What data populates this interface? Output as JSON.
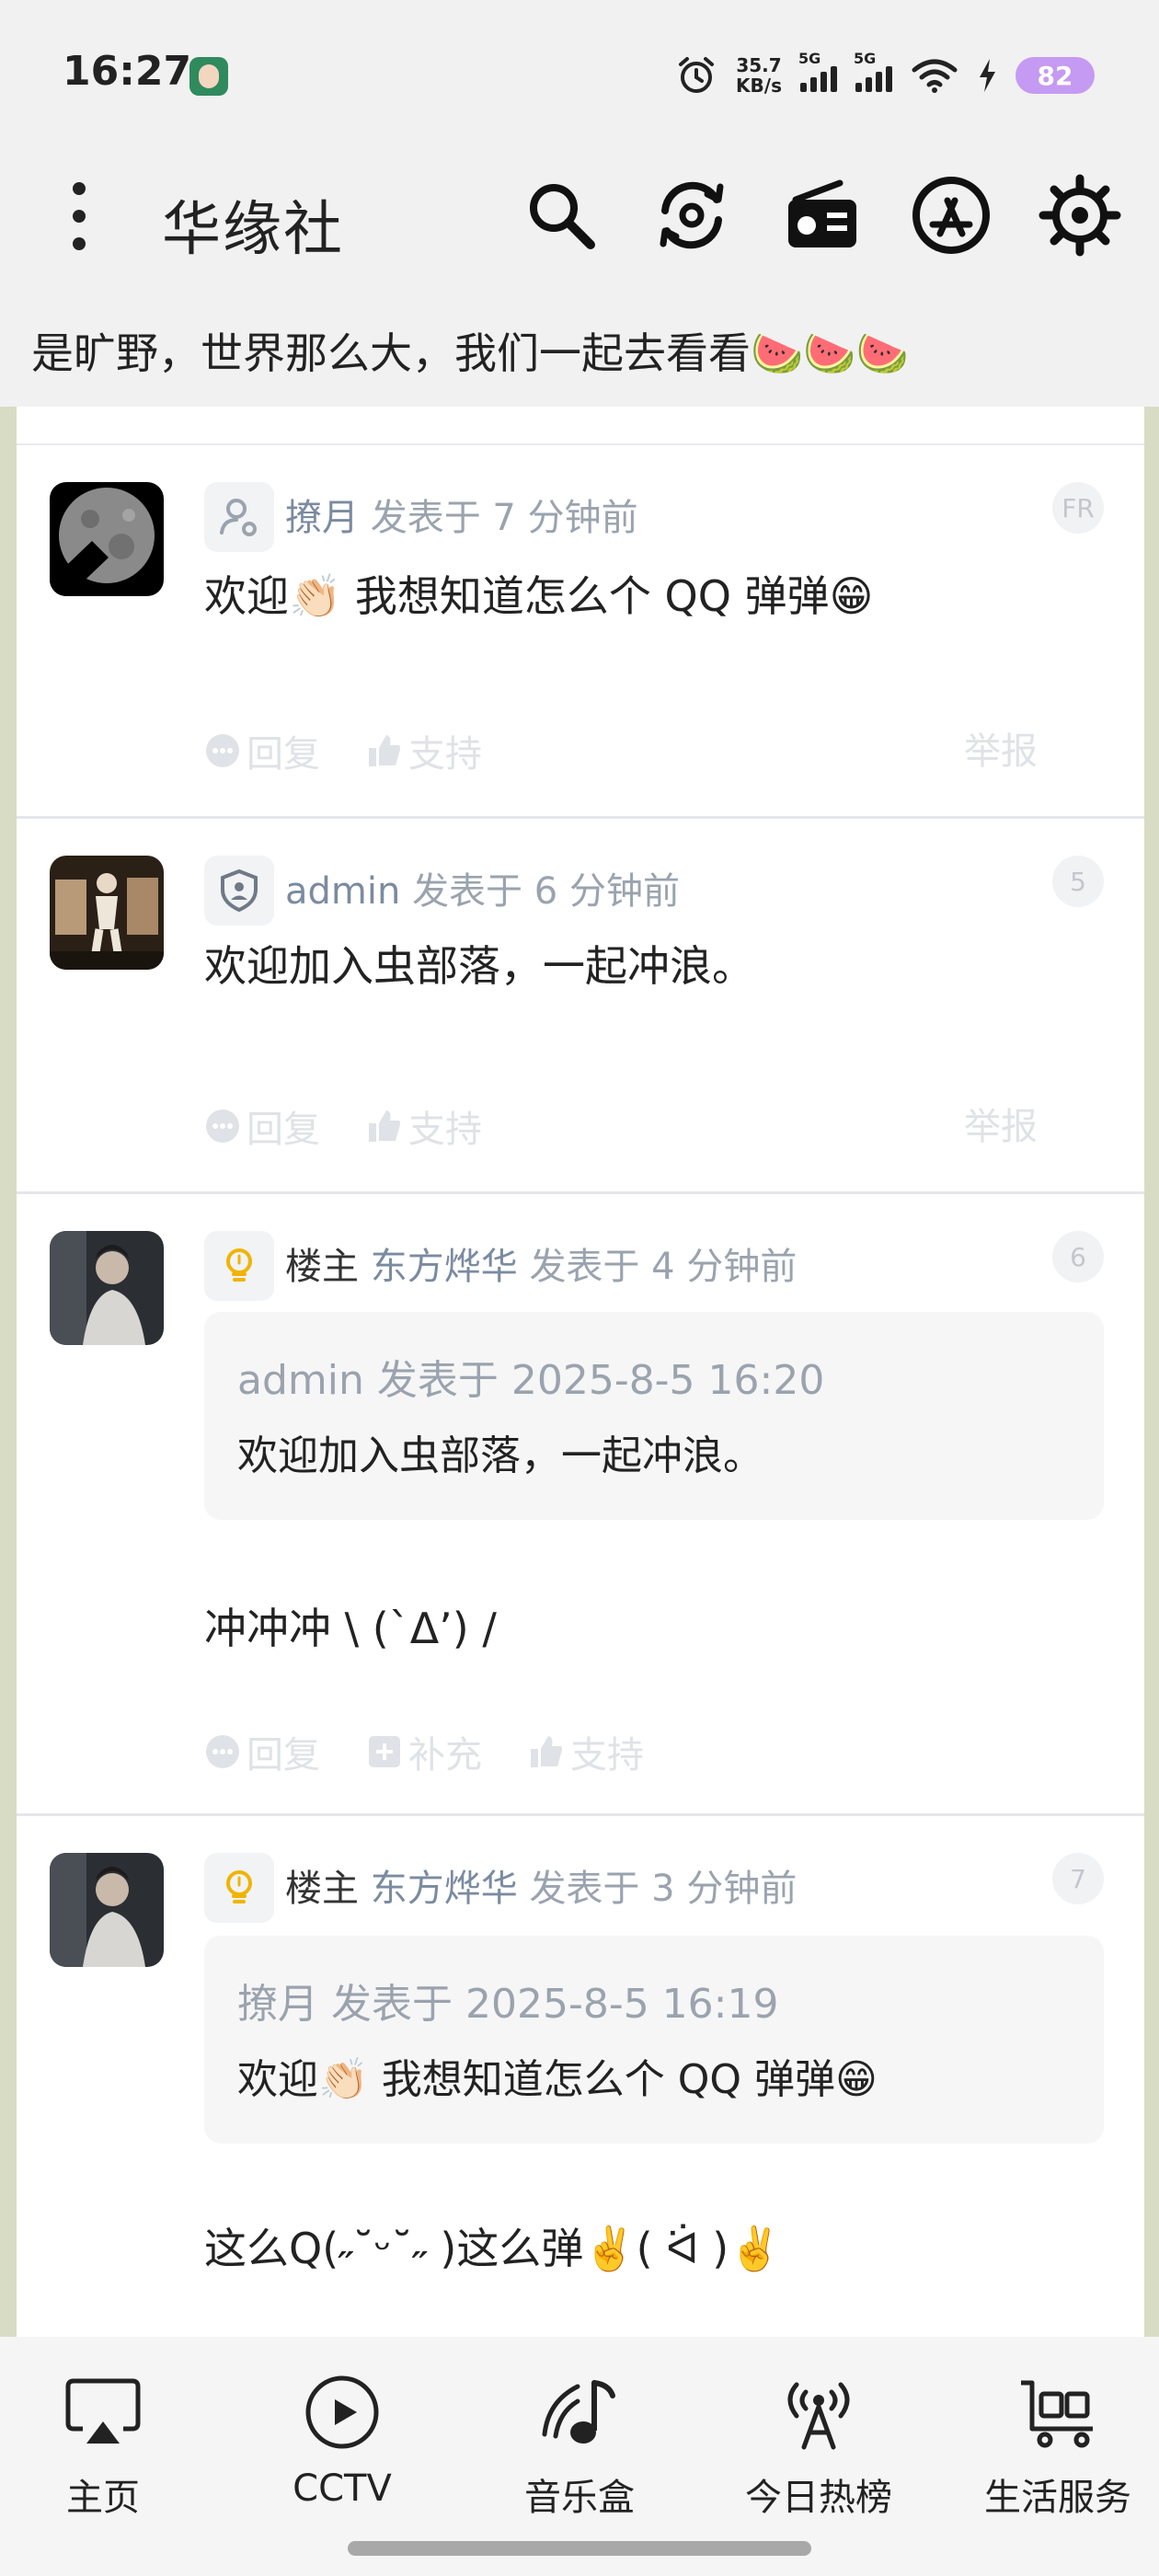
{
  "status_bar": {
    "time": "16:27",
    "net_speed_value": "35.7",
    "net_speed_unit": "KB/s",
    "signal1_label": "5G",
    "signal2_label": "5G",
    "battery": "82"
  },
  "app_bar": {
    "title": "华缘社",
    "icons": [
      "search-icon",
      "sync-icon",
      "radio-icon",
      "app-store-icon",
      "settings-icon"
    ]
  },
  "marquee": {
    "text": "是旷野，世界那么大，我们一起去看看🍉🍉🍉"
  },
  "posts": [
    {
      "author": "撩月",
      "time_text": "发表于 7 分钟前",
      "floor": "FR",
      "content": "欢迎👏🏻 我想知道怎么个 QQ 弹弹😁",
      "actions": [
        "回复",
        "支持"
      ],
      "report": "举报"
    },
    {
      "author": "admin",
      "time_text": "发表于 6 分钟前",
      "floor": "5",
      "content": "欢迎加入虫部落，一起冲浪。",
      "actions": [
        "回复",
        "支持"
      ],
      "report": "举报"
    },
    {
      "role": "楼主",
      "author": "东方烨华",
      "time_text": "发表于 4 分钟前",
      "floor": "6",
      "quote_meta": "admin 发表于 2025-8-5 16:20",
      "quote_text": "欢迎加入虫部落，一起冲浪。",
      "content": "冲冲冲 \\ (`Δ’) /",
      "actions": [
        "回复",
        "补充",
        "支持"
      ]
    },
    {
      "role": "楼主",
      "author": "东方烨华",
      "time_text": "发表于 3 分钟前",
      "floor": "7",
      "quote_meta": "撩月 发表于 2025-8-5 16:19",
      "quote_text": "欢迎👏🏻 我想知道怎么个 QQ 弹弹😁",
      "content": "这么Q(˶˘ᵕ˘˶ )这么弹✌️( ᐛ )✌️"
    }
  ],
  "bottom_nav": {
    "items": [
      {
        "label": "主页",
        "icon": "airplay-icon"
      },
      {
        "label": "CCTV",
        "icon": "play-circle-icon"
      },
      {
        "label": "音乐盒",
        "icon": "music-icon"
      },
      {
        "label": "今日热榜",
        "icon": "broadcast-icon"
      },
      {
        "label": "生活服务",
        "icon": "cart-icon"
      }
    ]
  }
}
